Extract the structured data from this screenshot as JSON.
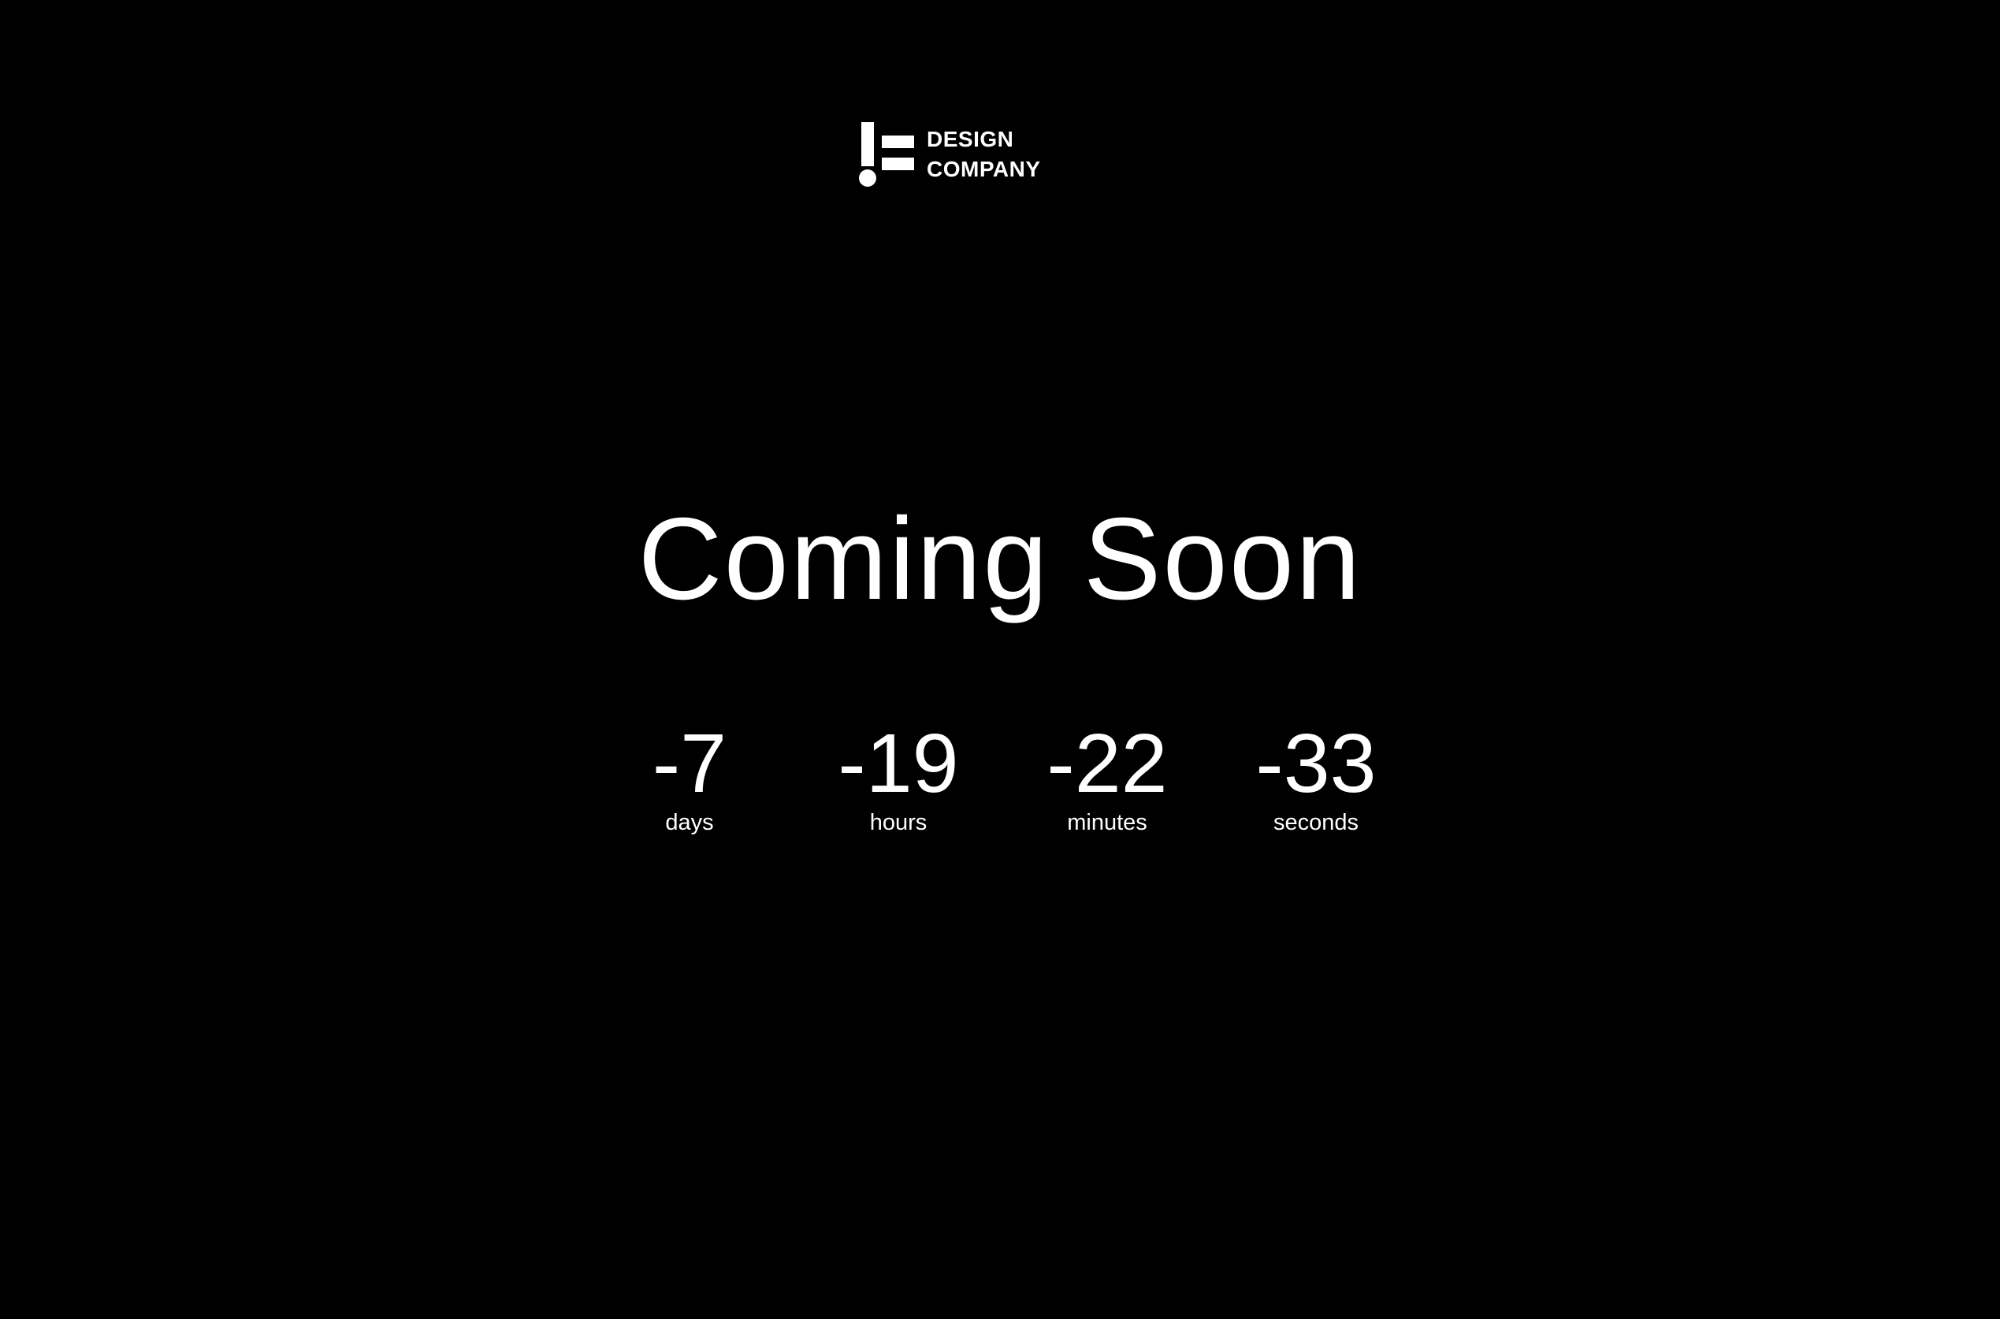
{
  "brand": {
    "logo_icon": "exclamation-bars-logo-icon",
    "line1": "DESIGN",
    "line2": "COMPANY"
  },
  "headline": "Coming Soon",
  "countdown": [
    {
      "value": "-7",
      "label": "days"
    },
    {
      "value": "-19",
      "label": "hours"
    },
    {
      "value": "-22",
      "label": "minutes"
    },
    {
      "value": "-33",
      "label": "seconds"
    }
  ],
  "colors": {
    "background": "#000000",
    "foreground": "#ffffff"
  }
}
